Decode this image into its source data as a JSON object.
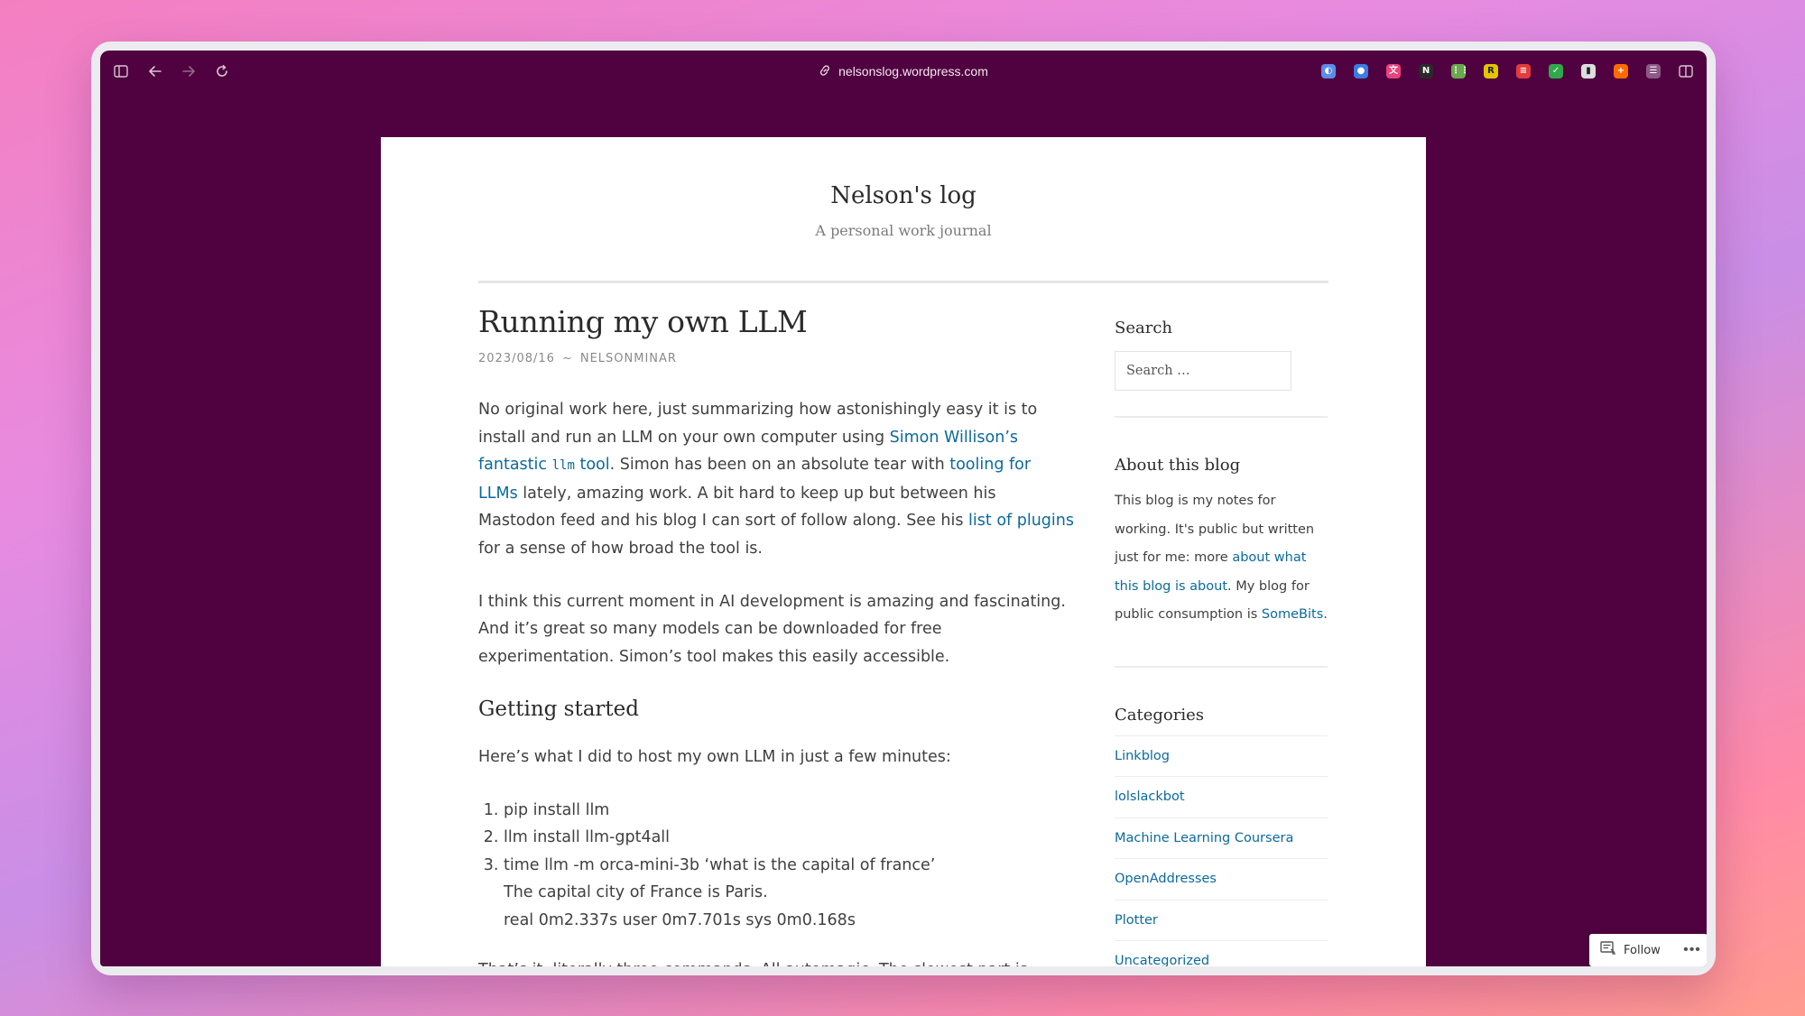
{
  "browser": {
    "url": "nelsonslog.wordpress.com",
    "icons": {
      "sidebar": "sidebar-toggle-icon",
      "back": "arrow-left-icon",
      "forward": "arrow-right-icon",
      "reload": "reload-icon",
      "link": "link-icon",
      "split": "split-view-icon"
    },
    "extensions": [
      {
        "name": "extension-globe-icon",
        "color": "#5b8de8",
        "glyph": "◐"
      },
      {
        "name": "extension-chat-icon",
        "color": "#3c7ce0",
        "glyph": "●"
      },
      {
        "name": "extension-translate-icon",
        "color": "#e8427c",
        "glyph": "文"
      },
      {
        "name": "extension-notion-icon",
        "color": "#2a2a2a",
        "glyph": "N"
      },
      {
        "name": "extension-grid-icon",
        "color": "#6aa84f",
        "glyph": "⋮⋮"
      },
      {
        "name": "extension-r-icon",
        "color": "#e3c400",
        "glyph": "R"
      },
      {
        "name": "extension-red-icon",
        "color": "#e23c3c",
        "glyph": "≡"
      },
      {
        "name": "extension-leaf-icon",
        "color": "#2fa84a",
        "glyph": "✓"
      },
      {
        "name": "extension-book-icon",
        "color": "#dddddd",
        "glyph": "▮"
      },
      {
        "name": "extension-orange-icon",
        "color": "#ff6a00",
        "glyph": "+"
      },
      {
        "name": "extension-reader-icon",
        "color": "#8c5a84",
        "glyph": "☰"
      }
    ]
  },
  "site": {
    "title": "Nelson's log",
    "description": "A personal work journal"
  },
  "post": {
    "title": "Running my own LLM",
    "date": "2023/08/16",
    "separator": "~",
    "author": "NELSONMINAR",
    "p1": {
      "t1": "No original work here, just summarizing how astonishingly easy it is to install and run an LLM on your own computer using ",
      "link1": "Simon Willison’s fantastic ",
      "link1_code": "llm",
      "link1_end": " tool",
      "t2": ". Simon has been on an absolute tear with ",
      "link2": "tooling for LLMs",
      "t3": " lately, amazing work. A bit hard to keep up but between his Mastodon feed and his blog I can sort of follow along. See his ",
      "link3": "list of plugins",
      "t4": " for a sense of how broad the tool is."
    },
    "p2": "I think this current moment in AI development is amazing and fascinating. And it’s great so many models can be downloaded for free experimentation. Simon’s tool makes this easily accessible.",
    "h2": "Getting started",
    "p3": "Here’s what I did to host my own LLM in just a few minutes:",
    "steps": [
      "pip install llm",
      "llm install llm-gpt4all",
      "time llm -m orca-mini-3b ‘what is the capital of france’"
    ],
    "step3_output1": "The capital city of France is Paris.",
    "step3_output2": "real 0m2.337s user 0m7.701s sys 0m0.168s",
    "p4": "That’s it, literally three commands. All automagic. The slowest part is"
  },
  "sidebar": {
    "search_title": "Search",
    "search_placeholder": "Search …",
    "about_title": "About this blog",
    "about_t1": "This blog is my notes for working. It's public but written just for me: more ",
    "about_link1": "about what this blog is about",
    "about_t2": ". My blog for public consumption is ",
    "about_link2": "SomeBits",
    "about_t3": ".",
    "categories_title": "Categories",
    "categories": [
      "Linkblog",
      "lolslackbot",
      "Machine Learning Coursera",
      "OpenAddresses",
      "Plotter",
      "Uncategorized"
    ]
  },
  "follow": {
    "label": "Follow",
    "more": "•••"
  }
}
